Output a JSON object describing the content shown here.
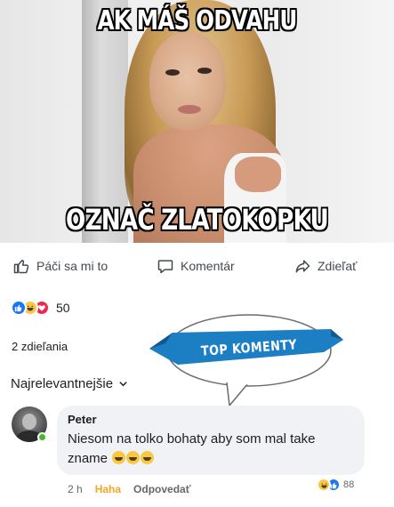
{
  "meme": {
    "top_text": "AK MÁŠ ODVAHU",
    "bottom_text": "OZNAČ ZLATOKOPKU"
  },
  "actions": {
    "like_label": "Páči sa mi to",
    "comment_label": "Komentár",
    "share_label": "Zdieľať"
  },
  "reactions": {
    "types": [
      "like",
      "haha",
      "love"
    ],
    "count": "50"
  },
  "shares_text": "2 zdieľania",
  "sort_label": "Najrelevantnejšie",
  "banner": {
    "label": "TOP KOMENTY",
    "color": "#1c7fc4"
  },
  "comment": {
    "author": "Peter",
    "text": "Niesom na tolko bohaty aby som mal take zname",
    "time": "2 h",
    "haha_label": "Haha",
    "reply_label": "Odpovedať",
    "reaction_types": [
      "haha",
      "like"
    ],
    "reaction_count": "88"
  },
  "colors": {
    "facebook_blue": "#1877f2",
    "haha_yellow": "#f7c844",
    "love_red": "#f0284a",
    "online_green": "#42b72a"
  }
}
